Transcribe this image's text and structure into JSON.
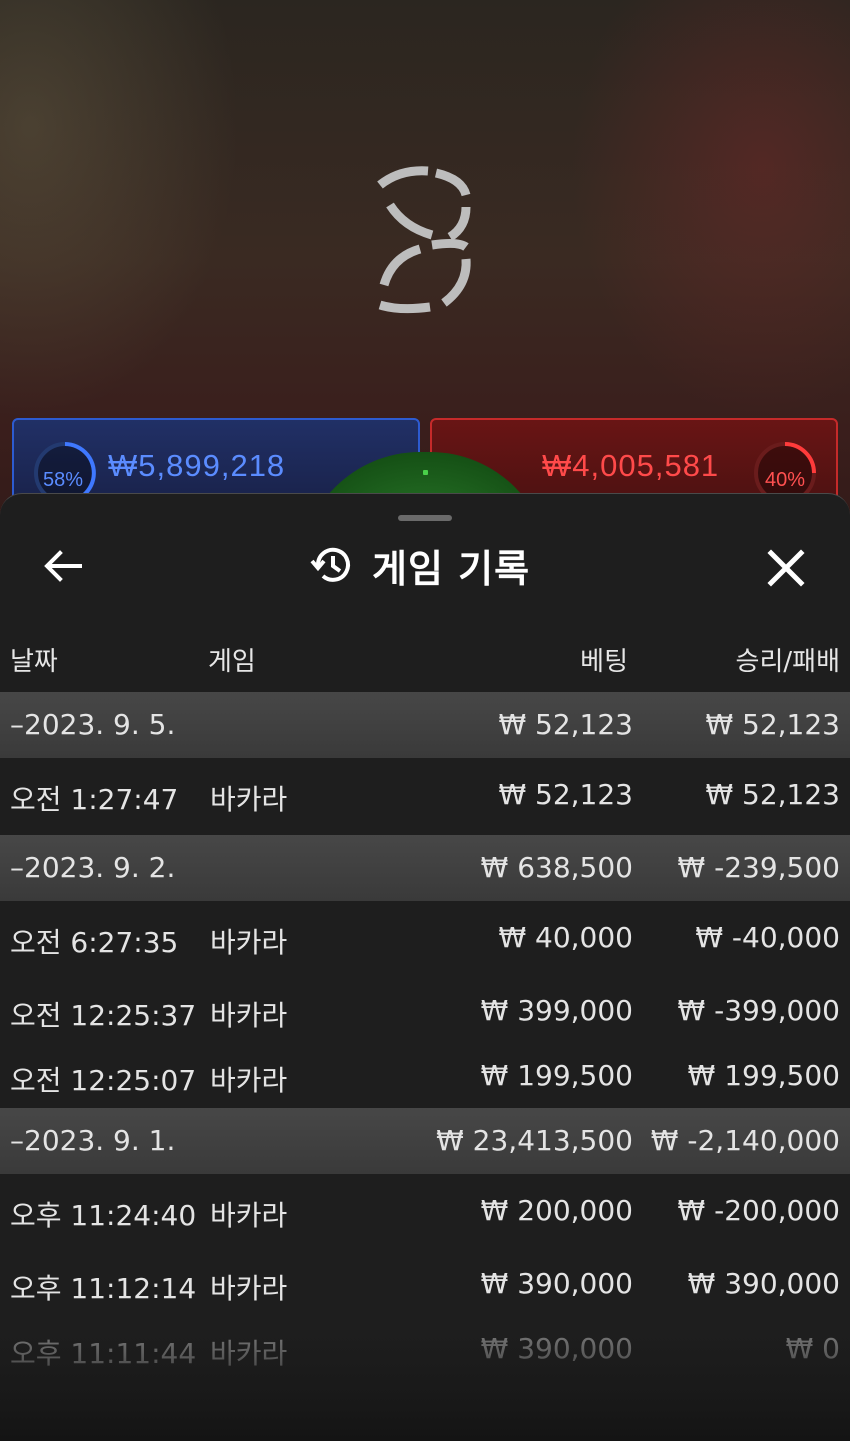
{
  "background": {
    "player": {
      "percent": "58%",
      "amount": "₩5,899,218",
      "color": "#2d5bd0"
    },
    "banker": {
      "percent": "40%",
      "amount": "₩4,005,581",
      "color": "#c62a2a"
    }
  },
  "sheet": {
    "title": "게임 기록",
    "icons": {
      "back": "arrow-left-icon",
      "history": "history-icon",
      "close": "close-icon"
    },
    "columns": {
      "date": "날짜",
      "game": "게임",
      "bet": "베팅",
      "result": "승리/패배"
    },
    "groups": [
      {
        "date": "–2023. 9. 5.",
        "bet": "₩ 52,123",
        "result": "₩ 52,123",
        "items": [
          {
            "time": "오전 1:27:47",
            "game": "바카라",
            "bet": "₩ 52,123",
            "result": "₩ 52,123"
          }
        ]
      },
      {
        "date": "–2023. 9. 2.",
        "bet": "₩ 638,500",
        "result": "₩ -239,500",
        "items": [
          {
            "time": "오전 6:27:35",
            "game": "바카라",
            "bet": "₩ 40,000",
            "result": "₩ -40,000"
          },
          {
            "time": "오전 12:25:37",
            "game": "바카라",
            "bet": "₩ 399,000",
            "result": "₩ -399,000"
          },
          {
            "time": "오전 12:25:07",
            "game": "바카라",
            "bet": "₩ 199,500",
            "result": "₩ 199,500"
          }
        ]
      },
      {
        "date": "–2023. 9. 1.",
        "bet": "₩ 23,413,500",
        "result": "₩ -2,140,000",
        "items": [
          {
            "time": "오후 11:24:40",
            "game": "바카라",
            "bet": "₩ 200,000",
            "result": "₩ -200,000"
          },
          {
            "time": "오후 11:12:14",
            "game": "바카라",
            "bet": "₩ 390,000",
            "result": "₩ 390,000"
          },
          {
            "time": "오후 11:11:44",
            "game": "바카라",
            "bet": "₩ 390,000",
            "result": "₩ 0"
          }
        ]
      }
    ]
  }
}
